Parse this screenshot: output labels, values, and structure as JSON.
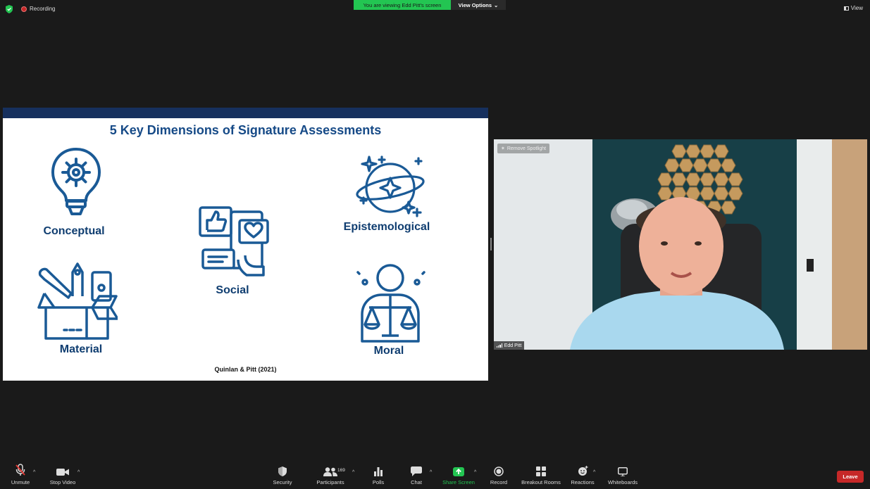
{
  "top_bar": {
    "recording_label": "Recording",
    "viewing_banner": "You are viewing Edd Pitt's screen",
    "view_options_label": "View Options",
    "view_label": "View"
  },
  "slide": {
    "title": "5 Key Dimensions of Signature Assessments",
    "dimensions": {
      "conceptual": "Conceptual",
      "social": "Social",
      "epistemological": "Epistemological",
      "material": "Material",
      "moral": "Moral"
    },
    "citation": "Quinlan & Pitt (2021)",
    "colors": {
      "band": "#16305e",
      "title": "#164a87",
      "icon": "#1a5a96"
    }
  },
  "video": {
    "remove_spotlight_label": "Remove Spotlight",
    "participant_name": "Edd Pitt"
  },
  "toolbar": {
    "unmute": "Unmute",
    "stop_video": "Stop Video",
    "security": "Security",
    "participants": "Participants",
    "participants_count": "169",
    "polls": "Polls",
    "chat": "Chat",
    "share_screen": "Share Screen",
    "record": "Record",
    "breakout_rooms": "Breakout Rooms",
    "reactions": "Reactions",
    "whiteboards": "Whiteboards",
    "leave": "Leave",
    "share_color": "#23c552",
    "leave_color": "#c62828"
  }
}
